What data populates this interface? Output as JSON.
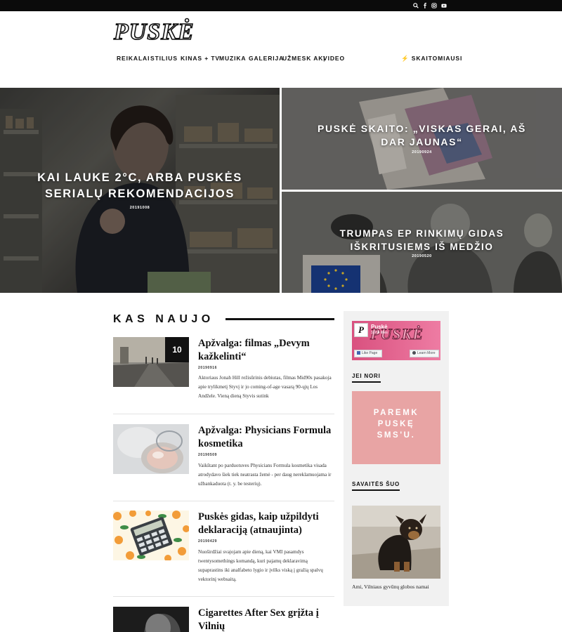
{
  "topbar": {
    "icons": [
      "search-icon",
      "facebook-icon",
      "instagram-icon",
      "youtube-icon"
    ]
  },
  "logo": {
    "text": "PUSKĖ"
  },
  "nav": {
    "items": [
      "REIKALAI",
      "STILIUS",
      "KINAS + TV",
      "MUZIKA",
      "GALERIJA",
      "UŽMESK AKĮ",
      "VIDEO"
    ],
    "trending_label": "⚡ SKAITOMIAUSI"
  },
  "hero": [
    {
      "title": "KAI LAUKE 2°C, ARBA PUSKĖS SERIALŲ REKOMENDACIJOS",
      "date": "20191008"
    },
    {
      "title": "PUSKĖ SKAITO: „VISKAS GERAI, AŠ DAR JAUNAS“",
      "date": "20190924"
    },
    {
      "title": "TRUMPAS EP RINKIMŲ GIDAS IŠKRITUSIEMS IŠ MEDŽIO",
      "date": "20190520"
    }
  ],
  "section": {
    "title": "KAS NAUJO"
  },
  "articles": [
    {
      "badge": "10",
      "title": "Apžvalga: filmas „Devym kažkelinti“",
      "date": "20190916",
      "excerpt": "Aktoriaus Jonah Hill režisūrinis debiutas, filmas Mid90s pasakoja apie trylikmetį Styvį ir jo coming-of-age vasarą 90-ųjų Los Andžele. Vieną dieną Styvis sutink"
    },
    {
      "badge": "",
      "title": "Apžvalga: Physicians Formula kosmetika",
      "date": "20190509",
      "excerpt": "Vaikštant po parduotuves Physicians Formula kosmetika visada atrodydavo šiek tiek neatrasta žemė - per daug nereklamuojama ir užbankaduota (t. y. be testerių)."
    },
    {
      "badge": "",
      "title": "Puskės gidas, kaip užpildyti deklaraciją (atnaujinta)",
      "date": "20190429",
      "excerpt": "Nuoširdžiai svajojam apie dieną, kai VMI pasamdys twentysomethings komandą, kuri pajamų deklaravimą supaprastins iki analfabeto lygio ir įvilks viską į gražią spalvų vektorinį websaitą."
    },
    {
      "badge": "",
      "title": "Cigarettes After Sex grįžta į Vilnių",
      "date": "",
      "excerpt": ""
    }
  ],
  "sidebar": {
    "fb_page_name": "Puskė",
    "fb_likes": "3,934 likes",
    "fb_logo": "PUSKĖ",
    "fb_like_button": "Like Page",
    "fb_learn_button": "Learn More",
    "jei_nori_title": "JEI NORI",
    "support_text": "PAREMK PUSKĘ SMS'U.",
    "week_title": "SAVAITĖS ŠUO",
    "week_caption": "Ami, Vilniaus gyvūnų globos namai"
  },
  "colors": {
    "accent_pink": "#e7628f",
    "support_bg": "#e8a4a4",
    "topbar_bg": "#0b0b0b"
  }
}
